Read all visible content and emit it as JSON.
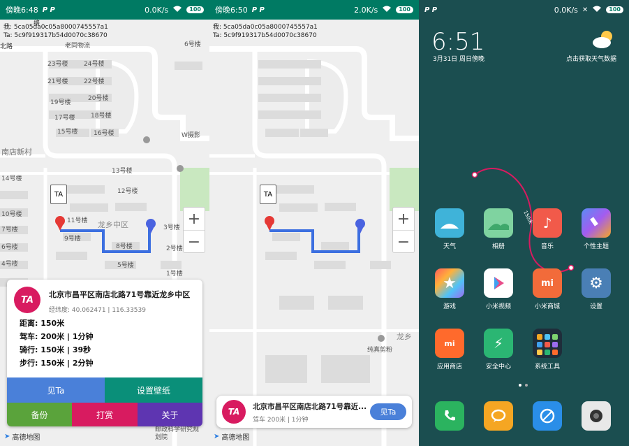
{
  "screen1": {
    "status": {
      "time": "傍晚6:48",
      "icons_left": "P  P",
      "net_speed": "0.0K/s",
      "battery": "100"
    },
    "debug": {
      "me": "我: 5ca05da0c05a8000745557a1",
      "ta": "Ta: 5c9f919317b54d0070c38670"
    },
    "map_labels": {
      "l1": "23号楼",
      "l2": "24号楼",
      "l3": "21号楼",
      "l4": "22号楼",
      "l5": "19号楼",
      "l6": "20号楼",
      "l7": "17号楼",
      "l8": "18号楼",
      "l9": "15号楼",
      "l10": "16号楼",
      "l11": "6号楼",
      "l12": "W摄影",
      "l13": "南店新村",
      "l14": "14号楼",
      "l15": "13号楼",
      "l16": "12号楼",
      "l17": "11号楼",
      "l18": "10号楼",
      "l19": "9号楼",
      "l20": "8号楼",
      "l21": "7号楼",
      "l22": "6号楼",
      "l23": "5号楼",
      "l24": "4号楼",
      "l25": "3号楼",
      "l26": "2号楼",
      "l27": "1号楼",
      "l28": "龙乡中区",
      "l29": "老同物流",
      "l30": "北路",
      "l31": "络"
    },
    "ta_label": "TA",
    "info": {
      "avatar": "TA",
      "address": "北京市昌平区南店北路71号靠近龙乡中区",
      "coords": "经纬度: 40.062471 | 116.33539",
      "distance": "距离: 150米",
      "drive": "驾车: 200米 | 1分钟",
      "ride": "骑行: 150米 | 39秒",
      "walk": "步行: 150米 | 2分钟"
    },
    "buttons": {
      "see": "见Ta",
      "wallpaper": "设置壁纸",
      "backup": "备份",
      "tip": "打赏",
      "about": "关于"
    },
    "bottom_labels": {
      "amap": "高德地图",
      "inst": "邮政科学研究规划院"
    }
  },
  "screen2": {
    "status": {
      "time": "傍晚6:50",
      "icons_left": "P  P",
      "net_speed": "2.0K/s",
      "battery": "100"
    },
    "debug": {
      "me": "我: 5ca05da0c05a8000745557a1",
      "ta": "Ta: 5c9f919317b54d0070c38670"
    },
    "ta_label": "TA",
    "map_labels": {
      "shop": "纯真剪粉",
      "long": "龙乡",
      "amap": "高德地图",
      "inst": "邮政科学研究规划院"
    },
    "card": {
      "avatar": "TA",
      "address": "北京市昌平区南店北路71号靠近...",
      "sub": "驾车 200米 | 1分钟",
      "button": "见Ta"
    }
  },
  "screen3": {
    "status": {
      "icons_left": "P  P",
      "net_speed": "0.0K/s",
      "battery": "100"
    },
    "clock": "6:51",
    "date": "3月31日 周日傍晚",
    "weather": "点击获取天气数据",
    "line_label": "150米",
    "apps": [
      {
        "label": "天气",
        "color": "#3fb3d9"
      },
      {
        "label": "相册",
        "color": "#7fd3a0"
      },
      {
        "label": "音乐",
        "color": "#f15a4a"
      },
      {
        "label": "个性主题",
        "color": "#7b6cf0"
      },
      {
        "label": "游戏",
        "color": "#ff8a3d"
      },
      {
        "label": "小米视频",
        "color": "#ffffff"
      },
      {
        "label": "小米商城",
        "color": "#f26b3a"
      },
      {
        "label": "设置",
        "color": "#4a7fb5"
      },
      {
        "label": "应用商店",
        "color": "#ff6a2c"
      },
      {
        "label": "安全中心",
        "color": "#2bb673"
      },
      {
        "label": "系统工具",
        "color": "#2c3e50"
      }
    ]
  }
}
